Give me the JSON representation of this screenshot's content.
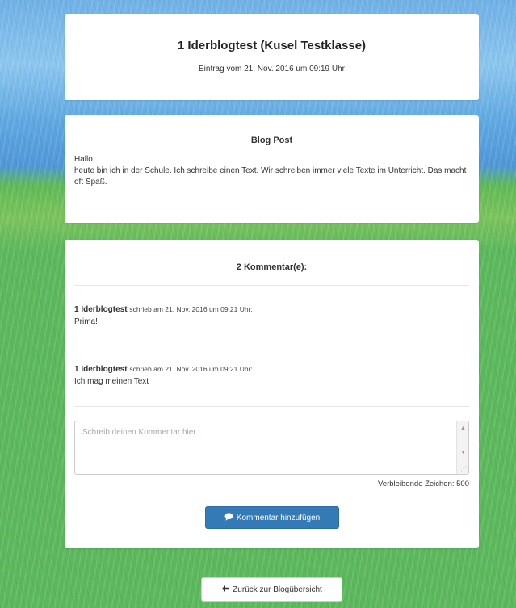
{
  "header": {
    "title": "1 Iderblogtest (Kusel Testklasse)",
    "date": "Eintrag vom 21. Nov. 2016 um 09:19 Uhr"
  },
  "post": {
    "heading": "Blog Post",
    "greeting": "Hallo,",
    "body": "heute bin ich in der Schule. Ich schreibe einen Text. Wir schreiben immer viele Texte im Unterricht. Das macht oft Spaß."
  },
  "comments": {
    "heading": "2 Kommentar(e):",
    "items": [
      {
        "author": "1 Iderblogtest",
        "meta": "schrieb am 21. Nov. 2016 um 09:21 Uhr:",
        "text": "Prima!"
      },
      {
        "author": "1 Iderblogtest",
        "meta": "schrieb am 21. Nov. 2016 um 09:21 Uhr:",
        "text": "Ich mag meinen Text"
      }
    ],
    "placeholder": "Schreib deinen Kommentar hier ...",
    "remaining": "Verbleibende Zeichen: 500",
    "submit_label": "Kommentar hinzufügen"
  },
  "nav": {
    "back_label": "Zurück zur Blogübersicht"
  },
  "icons": {
    "comment": "comment-icon",
    "back": "arrow-left-icon"
  },
  "colors": {
    "primary": "#337ab7",
    "background_green": "#5cb85c",
    "background_blue": "#5fa8e2"
  }
}
